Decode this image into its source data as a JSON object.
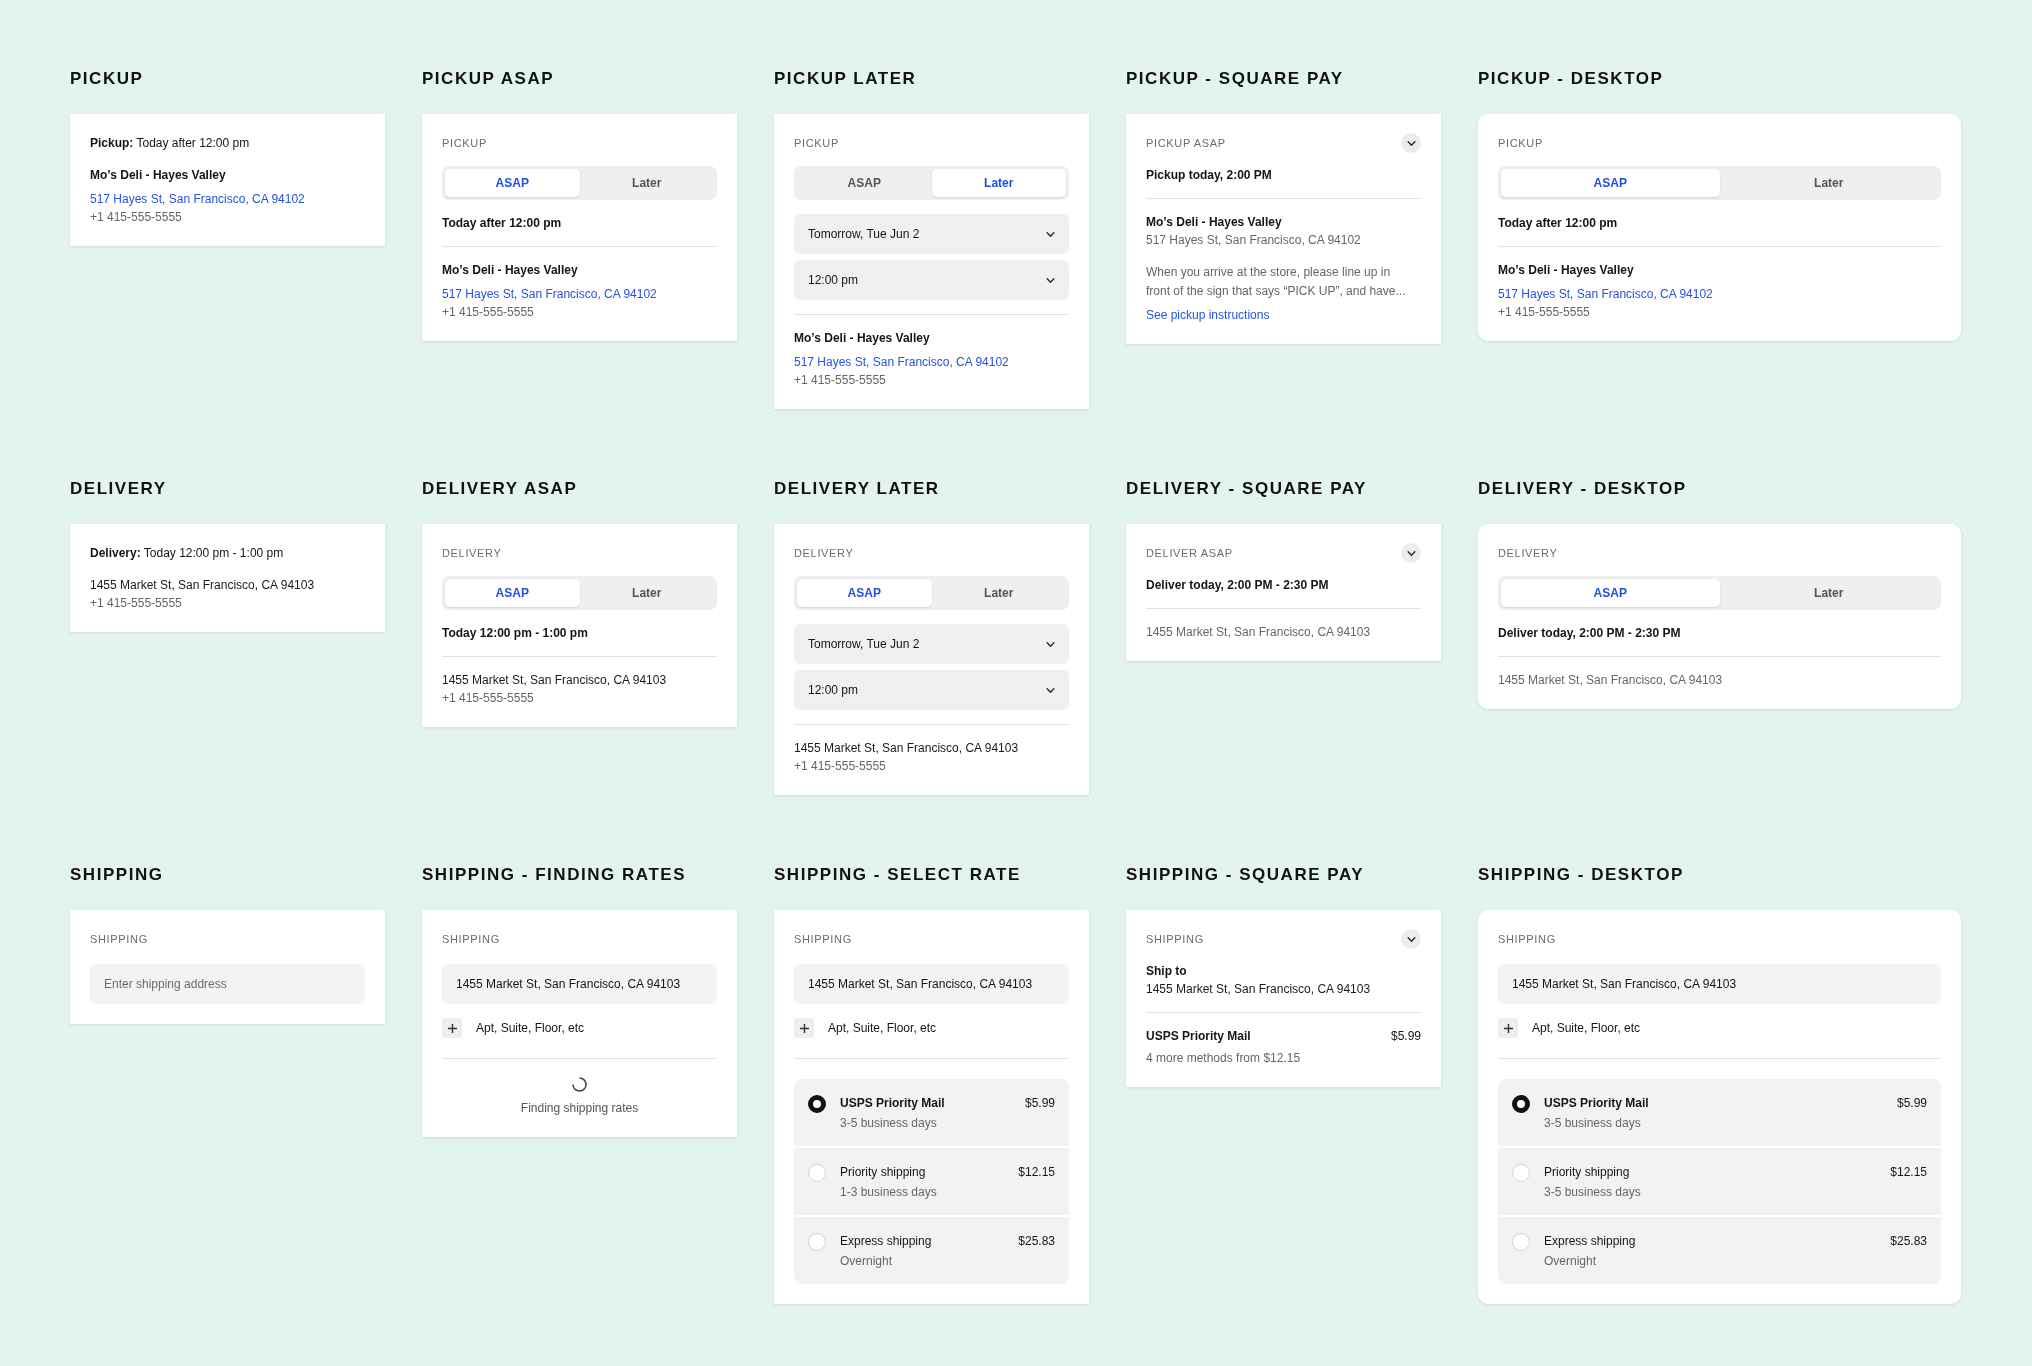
{
  "panels": [
    {
      "title": "PICKUP",
      "kind": "mobile",
      "blocks": [
        {
          "kind": "summary",
          "text": "**Pickup:** Today after 12:00 pm"
        },
        {
          "kind": "place",
          "lines": [
            {
              "kind": "title",
              "text": "Mo’s Deli - Hayes Valley"
            },
            {
              "kind": "link",
              "text": "517 Hayes St, San Francisco, CA 94102"
            },
            {
              "kind": "secondary",
              "text": "+1 415-555-5555"
            }
          ]
        }
      ]
    },
    {
      "title": "PICKUP ASAP",
      "kind": "mobile",
      "blocks": [
        {
          "kind": "label",
          "text": "PICKUP"
        },
        {
          "kind": "segmented",
          "options": [
            {
              "label": "ASAP",
              "selected": true
            },
            {
              "label": "Later",
              "selected": false
            }
          ]
        },
        {
          "kind": "heading",
          "text": "Today after 12:00 pm"
        },
        {
          "kind": "divider"
        },
        {
          "kind": "place",
          "lines": [
            {
              "kind": "title",
              "text": "Mo’s Deli - Hayes Valley"
            },
            {
              "kind": "link",
              "text": "517 Hayes St, San Francisco, CA 94102"
            },
            {
              "kind": "secondary",
              "text": "+1 415-555-5555"
            }
          ]
        }
      ]
    },
    {
      "title": "PICKUP LATER",
      "kind": "mobile",
      "blocks": [
        {
          "kind": "label",
          "text": "PICKUP"
        },
        {
          "kind": "segmented",
          "options": [
            {
              "label": "ASAP",
              "selected": false
            },
            {
              "label": "Later",
              "selected": true
            }
          ]
        },
        {
          "kind": "select",
          "value": "Tomorrow, Tue Jun 2"
        },
        {
          "kind": "select",
          "value": "12:00 pm"
        },
        {
          "kind": "divider"
        },
        {
          "kind": "place",
          "lines": [
            {
              "kind": "title",
              "text": "Mo’s Deli - Hayes Valley"
            },
            {
              "kind": "link",
              "text": "517 Hayes St, San Francisco, CA 94102"
            },
            {
              "kind": "secondary",
              "text": "+1 415-555-5555"
            }
          ]
        }
      ]
    },
    {
      "title": "PICKUP - SQUARE PAY",
      "kind": "mobile",
      "blocks": [
        {
          "kind": "label",
          "text": "PICKUP ASAP",
          "expanded": false
        },
        {
          "kind": "heading",
          "text": "Pickup today, 2:00 PM"
        },
        {
          "kind": "divider"
        },
        {
          "kind": "place",
          "lines": [
            {
              "kind": "title",
              "text": "Mo’s Deli - Hayes Valley"
            },
            {
              "kind": "secondary",
              "text": "517 Hayes St, San Francisco, CA 94102"
            }
          ]
        },
        {
          "kind": "note",
          "text": "When you arrive at the store, please line up in front of the sign that says “PICK UP”, and have...",
          "link": "See pickup instructions"
        }
      ]
    },
    {
      "title": "PICKUP - DESKTOP",
      "kind": "desktop",
      "blocks": [
        {
          "kind": "label",
          "text": "PICKUP"
        },
        {
          "kind": "segmented",
          "options": [
            {
              "label": "ASAP",
              "selected": true
            },
            {
              "label": "Later",
              "selected": false
            }
          ]
        },
        {
          "kind": "heading",
          "text": "Today after 12:00 pm"
        },
        {
          "kind": "divider"
        },
        {
          "kind": "place",
          "lines": [
            {
              "kind": "title",
              "text": "Mo’s Deli - Hayes Valley"
            },
            {
              "kind": "link",
              "text": "517 Hayes St, San Francisco, CA 94102"
            },
            {
              "kind": "secondary",
              "text": "+1 415-555-5555"
            }
          ]
        }
      ]
    },
    {
      "title": "DELIVERY",
      "kind": "mobile",
      "blocks": [
        {
          "kind": "summary",
          "text": "**Delivery:** Today 12:00 pm - 1:00 pm"
        },
        {
          "kind": "place",
          "lines": [
            {
              "kind": "text",
              "text": "1455 Market St, San Francisco, CA 94103"
            },
            {
              "kind": "secondary",
              "text": "+1 415-555-5555"
            }
          ]
        }
      ]
    },
    {
      "title": "DELIVERY ASAP",
      "kind": "mobile",
      "blocks": [
        {
          "kind": "label",
          "text": "DELIVERY"
        },
        {
          "kind": "segmented",
          "options": [
            {
              "label": "ASAP",
              "selected": true
            },
            {
              "label": "Later",
              "selected": false
            }
          ]
        },
        {
          "kind": "heading",
          "text": "Today 12:00 pm - 1:00 pm"
        },
        {
          "kind": "divider"
        },
        {
          "kind": "place",
          "lines": [
            {
              "kind": "text",
              "text": "1455 Market St, San Francisco, CA 94103"
            },
            {
              "kind": "secondary",
              "text": "+1 415-555-5555"
            }
          ]
        }
      ]
    },
    {
      "title": "DELIVERY LATER",
      "kind": "mobile",
      "blocks": [
        {
          "kind": "label",
          "text": "DELIVERY"
        },
        {
          "kind": "segmented",
          "options": [
            {
              "label": "ASAP",
              "selected": true
            },
            {
              "label": "Later",
              "selected": false
            }
          ]
        },
        {
          "kind": "select",
          "value": "Tomorrow, Tue Jun 2"
        },
        {
          "kind": "select",
          "value": "12:00 pm"
        },
        {
          "kind": "divider"
        },
        {
          "kind": "place",
          "lines": [
            {
              "kind": "text",
              "text": "1455 Market St, San Francisco, CA 94103"
            },
            {
              "kind": "secondary",
              "text": "+1 415-555-5555"
            }
          ]
        }
      ]
    },
    {
      "title": "DELIVERY - SQUARE PAY",
      "kind": "mobile",
      "blocks": [
        {
          "kind": "label",
          "text": "DELIVER ASAP",
          "expanded": false
        },
        {
          "kind": "heading",
          "text": "Deliver today, 2:00 PM - 2:30 PM"
        },
        {
          "kind": "divider"
        },
        {
          "kind": "place",
          "lines": [
            {
              "kind": "secondary",
              "text": "1455 Market St, San Francisco, CA 94103"
            }
          ]
        }
      ]
    },
    {
      "title": "DELIVERY - DESKTOP",
      "kind": "desktop",
      "blocks": [
        {
          "kind": "label",
          "text": "DELIVERY"
        },
        {
          "kind": "segmented",
          "options": [
            {
              "label": "ASAP",
              "selected": true
            },
            {
              "label": "Later",
              "selected": false
            }
          ]
        },
        {
          "kind": "heading",
          "text": "Deliver today, 2:00 PM - 2:30 PM"
        },
        {
          "kind": "divider"
        },
        {
          "kind": "place",
          "lines": [
            {
              "kind": "secondary",
              "text": "1455 Market St, San Francisco, CA 94103"
            }
          ]
        }
      ]
    },
    {
      "title": "SHIPPING",
      "kind": "mobile",
      "blocks": [
        {
          "kind": "label",
          "text": "SHIPPING"
        },
        {
          "kind": "input",
          "placeholder": "Enter shipping address"
        }
      ]
    },
    {
      "title": "SHIPPING - FINDING RATES",
      "kind": "mobile",
      "blocks": [
        {
          "kind": "label",
          "text": "SHIPPING"
        },
        {
          "kind": "input",
          "value": "1455 Market St, San Francisco, CA 94103"
        },
        {
          "kind": "add_line",
          "text": "Apt, Suite, Floor, etc"
        },
        {
          "kind": "divider"
        },
        {
          "kind": "loading",
          "text": "Finding shipping rates"
        }
      ]
    },
    {
      "title": "SHIPPING - SELECT RATE",
      "kind": "mobile",
      "blocks": [
        {
          "kind": "label",
          "text": "SHIPPING"
        },
        {
          "kind": "input",
          "value": "1455 Market St, San Francisco, CA 94103"
        },
        {
          "kind": "add_line",
          "text": "Apt, Suite, Floor, etc"
        },
        {
          "kind": "divider"
        },
        {
          "kind": "rates",
          "options": [
            {
              "name": "USPS Priority Mail",
              "detail": "3-5 business days",
              "price": "$5.99",
              "selected": true
            },
            {
              "name": "Priority shipping",
              "detail": "1-3 business days",
              "price": "$12.15",
              "selected": false
            },
            {
              "name": "Express shipping",
              "detail": "Overnight",
              "price": "$25.83",
              "selected": false
            }
          ]
        }
      ]
    },
    {
      "title": "SHIPPING - SQUARE PAY",
      "kind": "mobile",
      "blocks": [
        {
          "kind": "label",
          "text": "SHIPPING",
          "expanded": false
        },
        {
          "kind": "place",
          "lines": [
            {
              "kind": "title",
              "text": "Ship to"
            },
            {
              "kind": "text",
              "text": "1455 Market St, San Francisco, CA 94103"
            }
          ]
        },
        {
          "kind": "divider"
        },
        {
          "kind": "rate_summary",
          "name": "USPS Priority Mail",
          "price": "$5.99",
          "detail": "4 more methods from $12.15"
        }
      ]
    },
    {
      "title": "SHIPPING - DESKTOP",
      "kind": "desktop",
      "blocks": [
        {
          "kind": "label",
          "text": "SHIPPING"
        },
        {
          "kind": "input",
          "value": "1455 Market St, San Francisco, CA 94103"
        },
        {
          "kind": "add_line",
          "text": "Apt, Suite, Floor, etc"
        },
        {
          "kind": "divider"
        },
        {
          "kind": "rates",
          "options": [
            {
              "name": "USPS Priority Mail",
              "detail": "3-5 business days",
              "price": "$5.99",
              "selected": true
            },
            {
              "name": "Priority shipping",
              "detail": "3-5 business days",
              "price": "$12.15",
              "selected": false
            },
            {
              "name": "Express shipping",
              "detail": "Overnight",
              "price": "$25.83",
              "selected": false
            }
          ]
        }
      ]
    }
  ]
}
